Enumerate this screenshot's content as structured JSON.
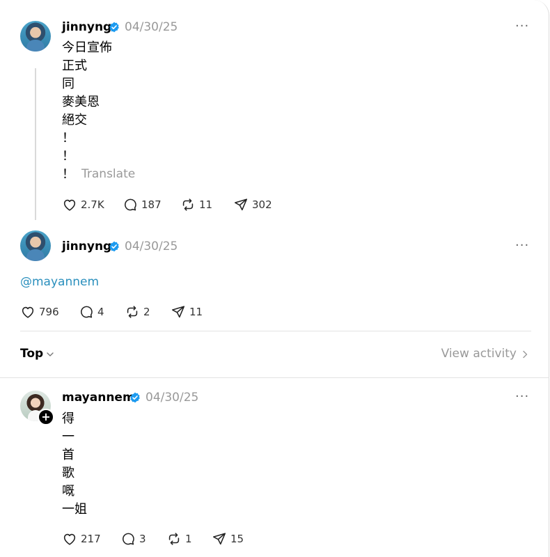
{
  "posts": [
    {
      "username": "jinnyng",
      "timestamp": "04/30/25",
      "lines": [
        "今日宣佈",
        "正式",
        "同",
        "麥美恩",
        "絕交",
        "！",
        "！",
        "！"
      ],
      "translate_label": "Translate",
      "likes": "2.7K",
      "comments": "187",
      "reposts": "11",
      "shares": "302"
    },
    {
      "username": "jinnyng",
      "timestamp": "04/30/25",
      "mention": "@mayannem",
      "likes": "796",
      "comments": "4",
      "reposts": "2",
      "shares": "11"
    }
  ],
  "replies_header": {
    "sort_label": "Top",
    "view_activity_label": "View activity"
  },
  "reply": {
    "username": "mayannem",
    "timestamp": "04/30/25",
    "lines": [
      "得",
      "一",
      "首",
      "歌",
      "嘅",
      "一姐"
    ],
    "likes": "217",
    "comments": "3",
    "reposts": "1",
    "shares": "15"
  },
  "more_glyph": "···",
  "follow_glyph": "+",
  "colors": {
    "verified": "#1d9bf0",
    "mention": "#2a8fbd",
    "muted": "#999999"
  },
  "icons": [
    "heart-icon",
    "comment-icon",
    "repost-icon",
    "share-icon",
    "verified-icon",
    "more-icon",
    "chevron-down-icon",
    "chevron-right-icon"
  ]
}
